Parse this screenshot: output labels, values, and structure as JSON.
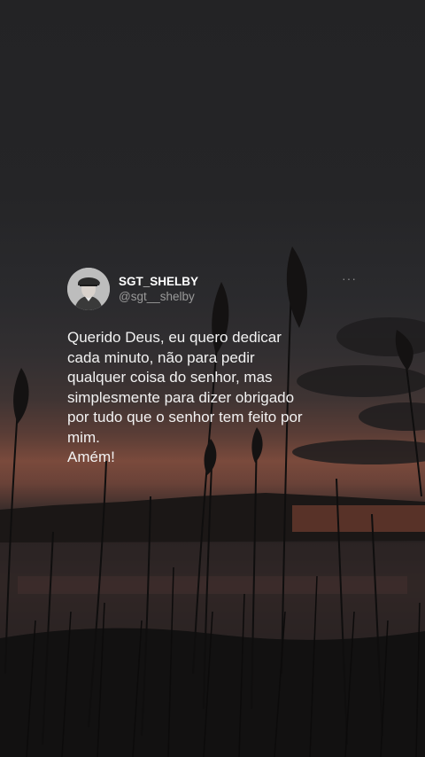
{
  "post": {
    "author": {
      "display_name": "SGT_SHELBY",
      "handle": "@sgt__shelby",
      "avatar_icon": "man-in-flat-cap-avatar"
    },
    "more_icon": "more-options-icon",
    "more_glyph": "···",
    "text_lines": [
      "Querido Deus, eu quero dedicar",
      "cada minuto, não para pedir",
      "qualquer coisa do senhor, mas",
      "simplesmente para dizer obrigado",
      "por tudo que o senhor tem feito por",
      "mim.",
      "Amém!"
    ]
  },
  "background": {
    "description_icon": "sunset-reeds-lake-photo",
    "colors": {
      "sky": "#242426",
      "horizon_glow": "#7a4a3c",
      "water": "#2b2322",
      "reeds": "#0f0e0e",
      "text": "#f2f2f2",
      "handle": "#9a9a9a"
    }
  }
}
